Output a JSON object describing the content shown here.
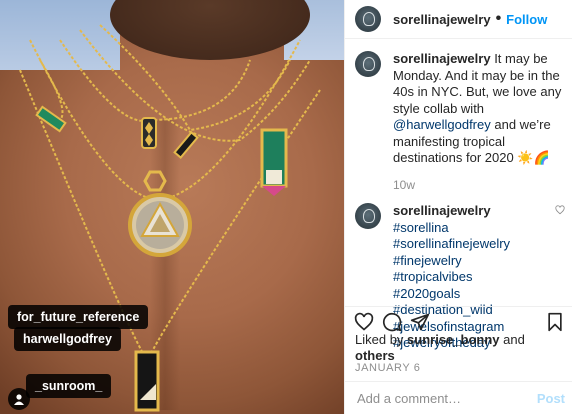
{
  "post": {
    "author": "sorellinajewelry",
    "follow_label": "Follow",
    "caption_user": "sorellinajewelry",
    "caption": "It may be Monday. And it may be in the 40s in NYC. But, we love any style collab with",
    "caption_mention": "@harwellgodfrey",
    "caption_end": "and we’re manifesting tropical destinations for 2020 ☀️🌈",
    "caption_time": "10w",
    "comment_user": "sorellinajewelry",
    "hashtags": [
      "#sorellina",
      "#sorellinafinejewelry",
      "#finejewelry",
      "#tropicalvibes",
      "#2020goals",
      "#destination_wild",
      "#jewelsofinstagram",
      "#jewelryoftheday"
    ],
    "likes_prefix": "Liked by",
    "likes_user": "sunrise_bonny",
    "likes_and": "and",
    "likes_others": "others",
    "date": "JANUARY 6",
    "comment_placeholder": "Add a comment…",
    "post_label": "Post"
  },
  "photo_tags": [
    "for_future_reference",
    "harwellgodfrey",
    "_sunroom_"
  ],
  "icons": {
    "heart": "heart-icon",
    "comment": "comment-icon",
    "share": "share-icon",
    "save": "bookmark-icon",
    "user_tag": "user-tag-icon"
  },
  "colors": {
    "accent": "#0095f6",
    "hashtag": "#00376b",
    "muted": "#8e8e8e",
    "post_disabled": "#b2dffc"
  }
}
